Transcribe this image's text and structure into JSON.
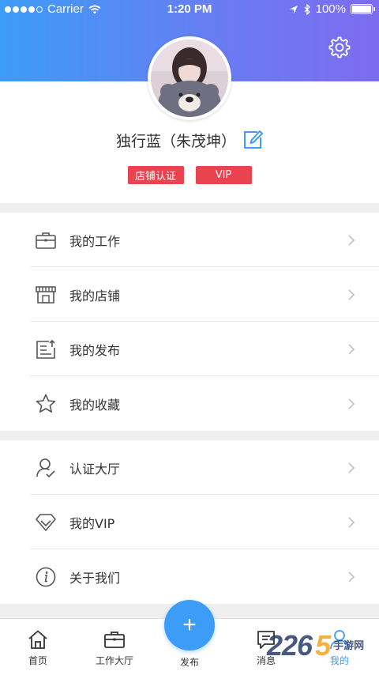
{
  "status_bar": {
    "carrier": "Carrier",
    "time": "1:20 PM",
    "battery": "100%"
  },
  "profile": {
    "name": "独行蓝（朱茂坤）",
    "badges": [
      "店铺认证",
      "VIP"
    ]
  },
  "menu_group_1": [
    {
      "label": "我的工作",
      "icon": "briefcase-icon"
    },
    {
      "label": "我的店铺",
      "icon": "store-icon"
    },
    {
      "label": "我的发布",
      "icon": "publish-list-icon"
    },
    {
      "label": "我的收藏",
      "icon": "star-icon"
    }
  ],
  "menu_group_2": [
    {
      "label": "认证大厅",
      "icon": "user-verify-icon"
    },
    {
      "label": "我的VIP",
      "icon": "diamond-icon"
    },
    {
      "label": "关于我们",
      "icon": "info-icon"
    }
  ],
  "tabbar": {
    "home": "首页",
    "work_hall": "工作大厅",
    "publish": "发布",
    "messages": "消息",
    "mine": "我的"
  },
  "watermark": {
    "number_a": "226",
    "number_b": "5",
    "text": "手游网",
    "domain_label": ""
  },
  "colors": {
    "accent": "#3d9cf7",
    "badge": "#e8434e",
    "header_gradient_start": "#3d9cf7",
    "header_gradient_end": "#7d6cf0"
  }
}
